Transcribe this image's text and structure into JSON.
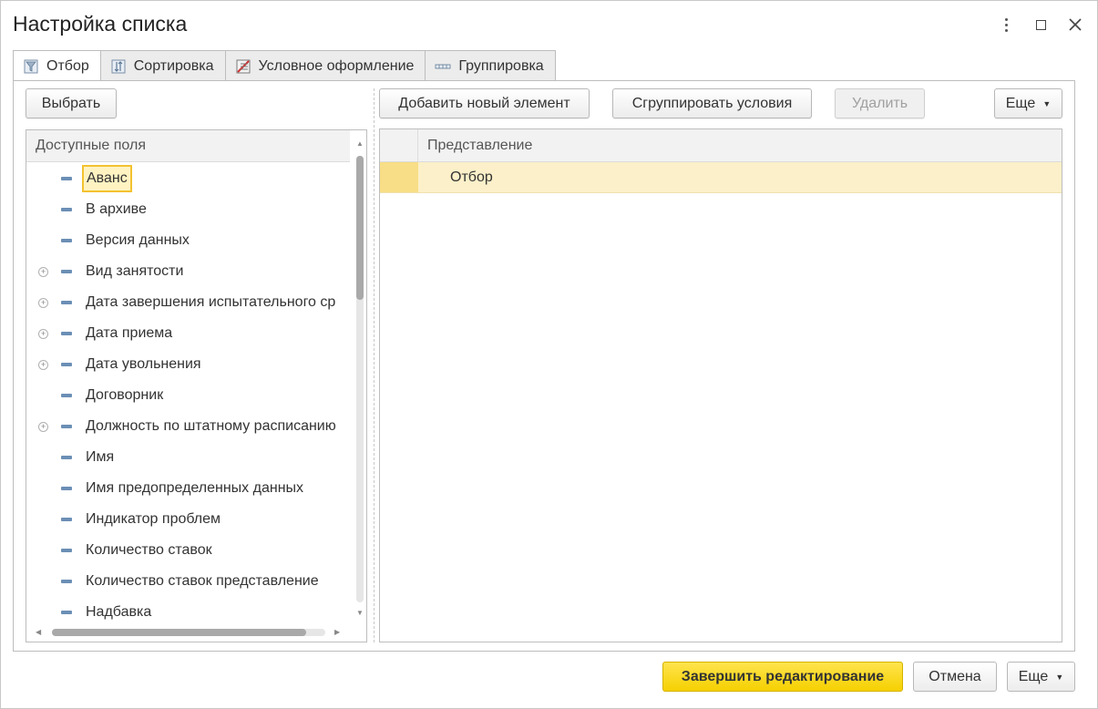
{
  "window": {
    "title": "Настройка списка",
    "controls": [
      "more-icon",
      "maximize-icon",
      "close-icon"
    ]
  },
  "tabs": [
    {
      "label": "Отбор",
      "icon": "filter-icon",
      "active": true
    },
    {
      "label": "Сортировка",
      "icon": "sort-icon",
      "active": false
    },
    {
      "label": "Условное оформление",
      "icon": "conditional-format-icon",
      "active": false
    },
    {
      "label": "Группировка",
      "icon": "grouping-icon",
      "active": false
    }
  ],
  "left": {
    "select_button": "Выбрать",
    "header": "Доступные поля",
    "fields": [
      {
        "label": "Аванс",
        "expandable": false,
        "selected": true
      },
      {
        "label": "В архиве",
        "expandable": false
      },
      {
        "label": "Версия данных",
        "expandable": false
      },
      {
        "label": "Вид занятости",
        "expandable": true
      },
      {
        "label": "Дата завершения испытательного ср",
        "expandable": true
      },
      {
        "label": "Дата приема",
        "expandable": true
      },
      {
        "label": "Дата увольнения",
        "expandable": true
      },
      {
        "label": "Договорник",
        "expandable": false
      },
      {
        "label": "Должность по штатному расписанию",
        "expandable": true
      },
      {
        "label": "Имя",
        "expandable": false
      },
      {
        "label": "Имя предопределенных данных",
        "expandable": false
      },
      {
        "label": "Индикатор проблем",
        "expandable": false
      },
      {
        "label": "Количество ставок",
        "expandable": false
      },
      {
        "label": "Количество ставок представление",
        "expandable": false
      },
      {
        "label": "Надбавка",
        "expandable": false
      }
    ]
  },
  "right": {
    "toolbar": {
      "add": "Добавить новый элемент",
      "group": "Сгруппировать условия",
      "delete": "Удалить",
      "more": "Еще"
    },
    "column_header": "Представление",
    "rows": [
      {
        "value": "Отбор"
      }
    ]
  },
  "footer": {
    "finish": "Завершить редактирование",
    "cancel": "Отмена",
    "more": "Еще"
  },
  "colors": {
    "accent_yellow": "#f5d000",
    "selection_bg": "#fbf0c9",
    "field_icon": "#6b8fb5"
  }
}
